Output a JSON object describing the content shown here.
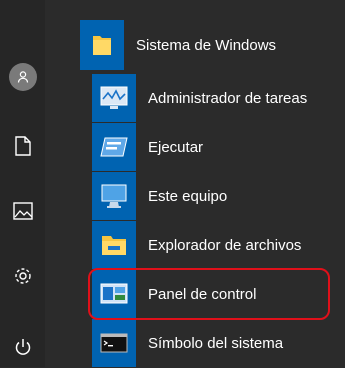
{
  "folder": {
    "label": "Sistema de Windows",
    "icon": "folder-icon"
  },
  "apps": [
    {
      "label": "Administrador de tareas",
      "icon": "task-manager-icon"
    },
    {
      "label": "Ejecutar",
      "icon": "run-icon"
    },
    {
      "label": "Este equipo",
      "icon": "this-pc-icon"
    },
    {
      "label": "Explorador de archivos",
      "icon": "file-explorer-icon"
    },
    {
      "label": "Panel de control",
      "icon": "control-panel-icon"
    },
    {
      "label": "Símbolo del sistema",
      "icon": "command-prompt-icon"
    }
  ],
  "rail": [
    "user-icon",
    "documents-icon",
    "pictures-icon",
    "settings-icon",
    "power-icon"
  ],
  "colors": {
    "accent": "#0063b1",
    "highlight": "#e0101a",
    "background": "#2b2b2b"
  }
}
